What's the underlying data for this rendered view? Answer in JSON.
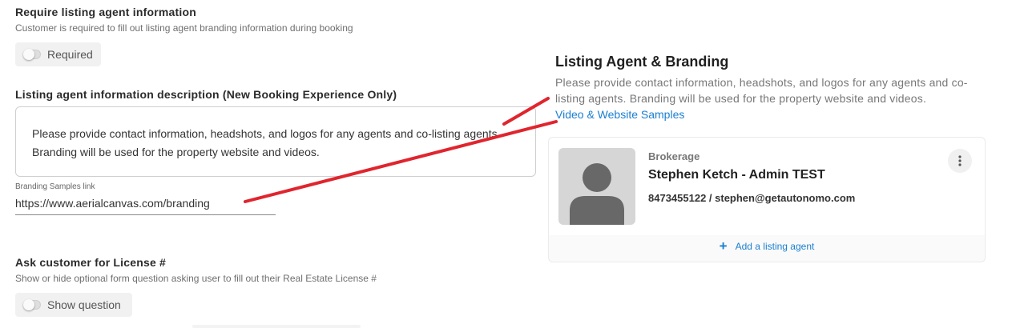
{
  "require_section": {
    "title": "Require listing agent information",
    "description": "Customer is required to fill out listing agent branding information during booking",
    "toggle_label": "Required",
    "toggle_on": false
  },
  "description_section": {
    "title": "Listing agent information description (New Booking Experience Only)",
    "text": "Please provide contact information, headshots, and logos for any agents and co-listing agents. Branding will be used for the property website and videos."
  },
  "branding_link": {
    "label": "Branding Samples link",
    "value": "https://www.aerialcanvas.com/branding"
  },
  "license_section": {
    "title": "Ask customer for License #",
    "description": "Show or hide optional form question asking user to fill out their Real Estate License #",
    "toggle_label": "Show question",
    "toggle_on": false
  },
  "preview": {
    "title": "Listing Agent & Branding",
    "description": "Please provide contact information, headshots, and logos for any agents and co-listing agents. Branding will be used for the property website and videos.",
    "link_text": "Video & Website Samples",
    "agent": {
      "brokerage": "Brokerage",
      "name": "Stephen Ketch - Admin TEST",
      "contact": "8473455122 / stephen@getautonomo.com"
    },
    "add_agent_label": "Add a listing agent"
  },
  "colors": {
    "link": "#1a7fd0",
    "annotation": "#e0252e"
  }
}
